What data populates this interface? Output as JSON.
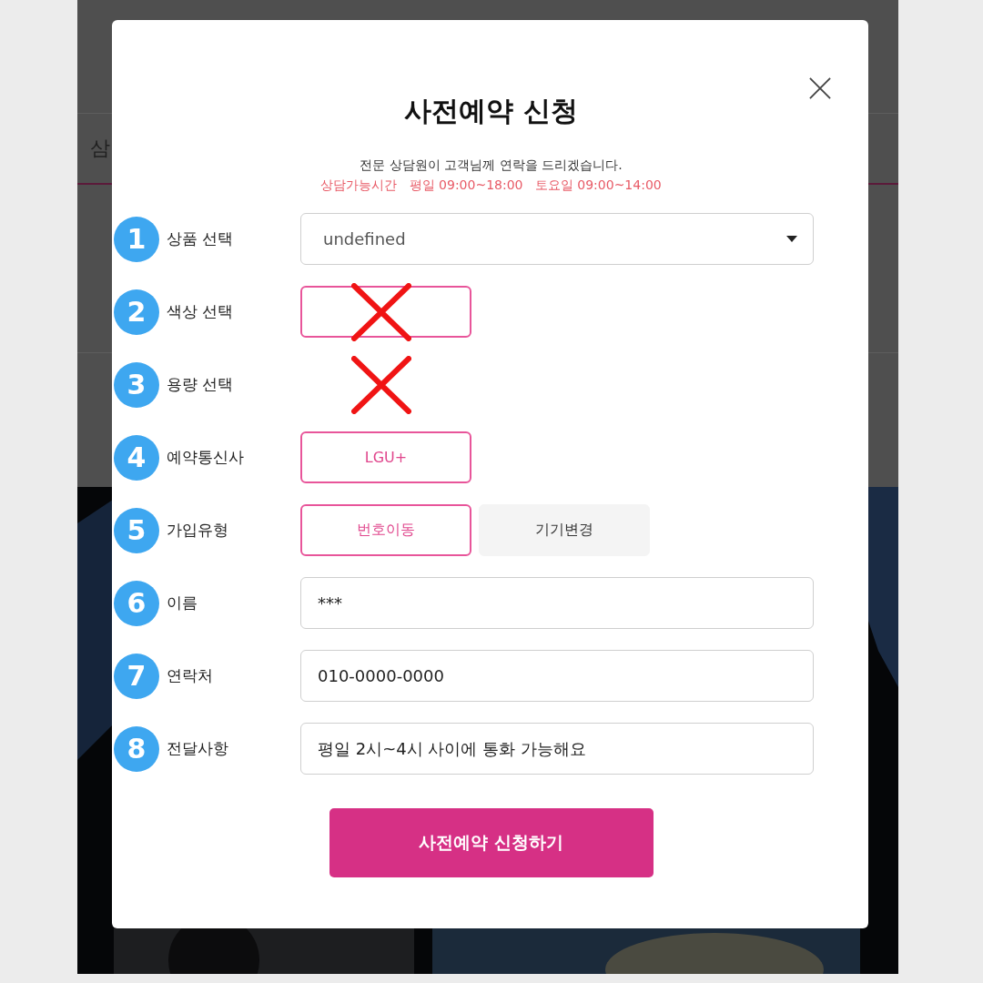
{
  "backdrop": {
    "tab_text": "삼"
  },
  "modal": {
    "title": "사전예약 신청",
    "subtitle": "전문 상담원이 고객님께 연락을 드리겠습니다.",
    "hours": "상담가능시간   평일 09:00~18:00   토요일 09:00~14:00",
    "fields": [
      {
        "number": "1",
        "label": "상품 선택",
        "kind": "select",
        "value": "undefined"
      },
      {
        "number": "2",
        "label": "색상 선택",
        "kind": "options",
        "options": [
          {
            "selected": true
          }
        ],
        "crossed": true
      },
      {
        "number": "3",
        "label": "용량 선택",
        "kind": "none",
        "crossed": true
      },
      {
        "number": "4",
        "label": "예약통신사",
        "kind": "options",
        "options": [
          {
            "label": "LGU+",
            "selected": true
          }
        ]
      },
      {
        "number": "5",
        "label": "가입유형",
        "kind": "options",
        "options": [
          {
            "label": "번호이동",
            "selected": true
          },
          {
            "label": "기기변경",
            "selected": false
          }
        ]
      },
      {
        "number": "6",
        "label": "이름",
        "kind": "input",
        "value": "***"
      },
      {
        "number": "7",
        "label": "연락처",
        "kind": "input",
        "value": "010-0000-0000"
      },
      {
        "number": "8",
        "label": "전달사항",
        "kind": "input",
        "value": "평일 2시~4시 사이에 통화 가능해요"
      }
    ],
    "submit": "사전예약 신청하기"
  }
}
